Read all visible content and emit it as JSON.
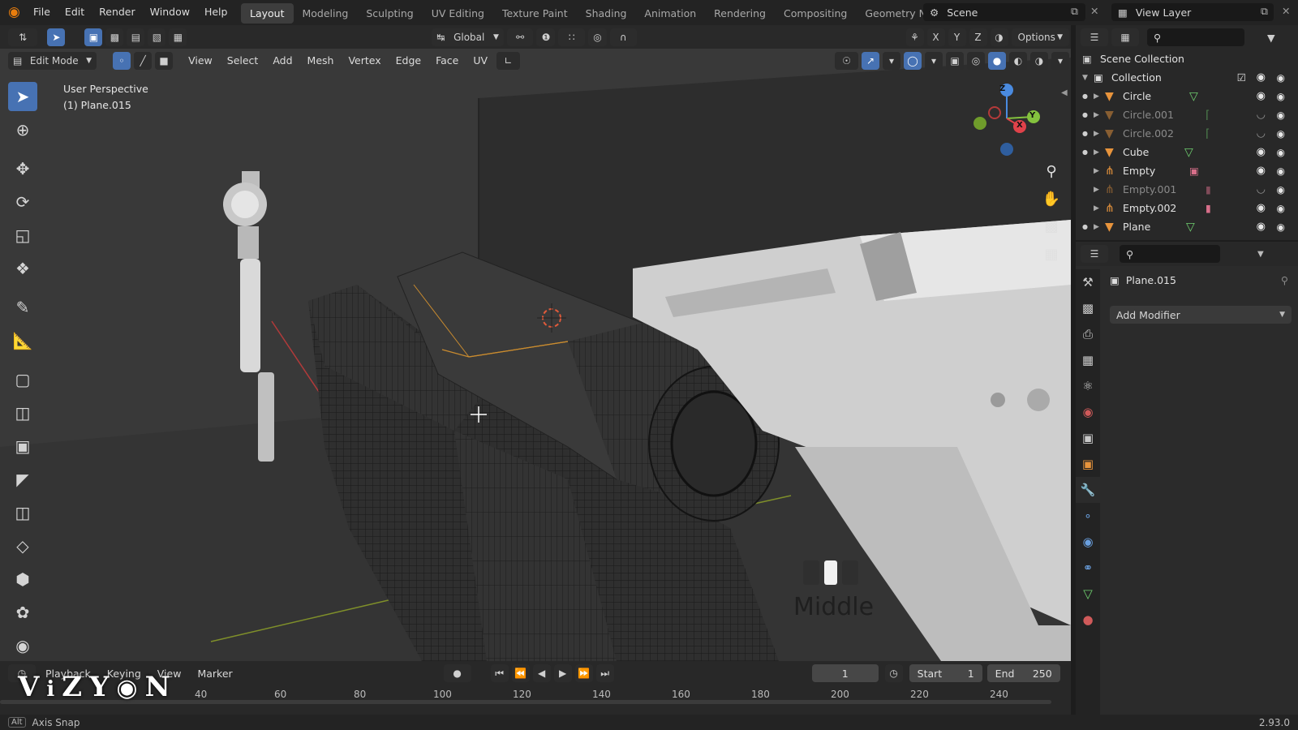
{
  "topbar": {
    "menu": [
      "File",
      "Edit",
      "Render",
      "Window",
      "Help"
    ],
    "workspaces": [
      "Layout",
      "Modeling",
      "Sculpting",
      "UV Editing",
      "Texture Paint",
      "Shading",
      "Animation",
      "Rendering",
      "Compositing",
      "Geometry Nod"
    ],
    "active_workspace": "Layout",
    "scene": "Scene",
    "view_layer": "View Layer"
  },
  "viewport": {
    "transform_orientation": "Global",
    "options_label": "Options",
    "axes": [
      "X",
      "Y",
      "Z"
    ],
    "mode": "Edit Mode",
    "menus": [
      "View",
      "Select",
      "Add",
      "Mesh",
      "Vertex",
      "Edge",
      "Face",
      "UV"
    ],
    "perspective_label": "User Perspective",
    "object_label": "(1) Plane.015",
    "key_overlay_label": "Middle",
    "gizmo": {
      "x": "X",
      "y": "Y",
      "z": "Z"
    }
  },
  "timeline": {
    "menus": [
      "Playback",
      "Keying",
      "View",
      "Marker"
    ],
    "current_frame": "1",
    "start_label": "Start",
    "start_value": "1",
    "end_label": "End",
    "end_value": "250",
    "ticks": [
      "40",
      "60",
      "80",
      "100",
      "120",
      "140",
      "160",
      "180",
      "200",
      "220",
      "240"
    ]
  },
  "status": {
    "key": "Alt",
    "hint": "Axis Snap",
    "version": "2.93.0"
  },
  "outliner": {
    "scene_collection": "Scene Collection",
    "collection": "Collection",
    "items": [
      {
        "name": "Circle",
        "type": "mesh",
        "hidden": false
      },
      {
        "name": "Circle.001",
        "type": "mesh",
        "hidden": true
      },
      {
        "name": "Circle.002",
        "type": "mesh",
        "hidden": true
      },
      {
        "name": "Cube",
        "type": "mesh",
        "hidden": false
      },
      {
        "name": "Empty",
        "type": "empty",
        "hidden": false
      },
      {
        "name": "Empty.001",
        "type": "empty",
        "hidden": true
      },
      {
        "name": "Empty.002",
        "type": "empty",
        "hidden": false
      },
      {
        "name": "Plane",
        "type": "mesh",
        "hidden": false
      }
    ]
  },
  "properties": {
    "object_name": "Plane.015",
    "add_modifier_label": "Add Modifier"
  },
  "watermark": "ViZYON",
  "colors": {
    "accent": "#4772b3",
    "object_orange": "#e8943c",
    "mesh_green": "#6fcf6f"
  }
}
